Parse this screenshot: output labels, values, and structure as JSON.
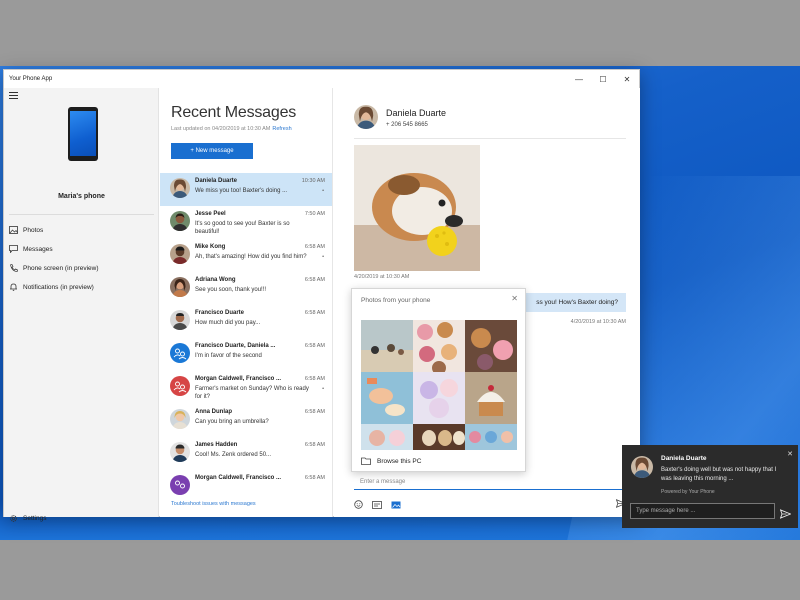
{
  "app": {
    "title": "Your Phone App"
  },
  "window_controls": {
    "minimize": "—",
    "maximize": "☐",
    "close": "✕"
  },
  "nav": {
    "phone_name": "Maria's phone",
    "items": [
      {
        "label": "Photos"
      },
      {
        "label": "Messages"
      },
      {
        "label": "Phone screen (in preview)"
      },
      {
        "label": "Notifications (in preview)"
      }
    ],
    "settings": "Settings"
  },
  "list": {
    "heading": "Recent Messages",
    "updated": "Last updated on 04/20/2019 at 10:30 AM",
    "refresh": "Refresh",
    "new_message": "+ New message",
    "troubleshoot": "Toubleshoot issues with messages",
    "conversations": [
      {
        "name": "Daniela Duarte",
        "time": "10:30 AM",
        "preview": "We miss you too! Baxter's doing ...",
        "marker": "•"
      },
      {
        "name": "Jesse Peel",
        "time": "7:50 AM",
        "preview": "It's so good to see you! Baxter is so beautiful!",
        "marker": ""
      },
      {
        "name": "Mike Kong",
        "time": "6:58 AM",
        "preview": "Ah, that's amazing! How did you find him?",
        "marker": "•"
      },
      {
        "name": "Adriana Wong",
        "time": "6:58 AM",
        "preview": "See you soon, thank you!!!",
        "marker": ""
      },
      {
        "name": "Francisco Duarte",
        "time": "6:58 AM",
        "preview": "How much did you pay...",
        "marker": ""
      },
      {
        "name": "Francisco Duarte, Daniela ...",
        "time": "6:58 AM",
        "preview": "I'm in favor of the second",
        "marker": ""
      },
      {
        "name": "Morgan Caldwell, Francisco ...",
        "time": "6:58 AM",
        "preview": "Farmer's market on Sunday? Who is ready for it?",
        "marker": "•"
      },
      {
        "name": "Anna Dunlap",
        "time": "6:58 AM",
        "preview": "Can you bring an umbrella?",
        "marker": ""
      },
      {
        "name": "James Hadden",
        "time": "6:58 AM",
        "preview": "Cool! Ms. Zenk ordered 50...",
        "marker": ""
      },
      {
        "name": "Morgan Caldwell, Francisco ...",
        "time": "6:58 AM",
        "preview": "",
        "marker": ""
      }
    ]
  },
  "chat": {
    "contact_name": "Daniela Duarte",
    "contact_phone": "+ 206 545 8665",
    "photo_time": "4/20/2019 at 10:30 AM",
    "outgoing_text": "ss you! How's Baxter doing?",
    "outgoing_time": "4/20/2019 at 10:30 AM",
    "compose_placeholder": "Enter a message"
  },
  "photos_popup": {
    "title": "Photos from your phone",
    "close": "✕",
    "browse": "Browse this PC"
  },
  "toast": {
    "name": "Daniela Duarte",
    "body": "Baxter's doing well but was not happy that I was leaving this morning ...",
    "powered": "Powered by Your Phone",
    "reply_placeholder": "Type message here ...",
    "close": "✕"
  },
  "colors": {
    "accent": "#1a6fd0",
    "selected_row": "#cde4f7",
    "outgoing_bubble": "#d4e6f7",
    "toast_bg": "#2b2b2b"
  }
}
